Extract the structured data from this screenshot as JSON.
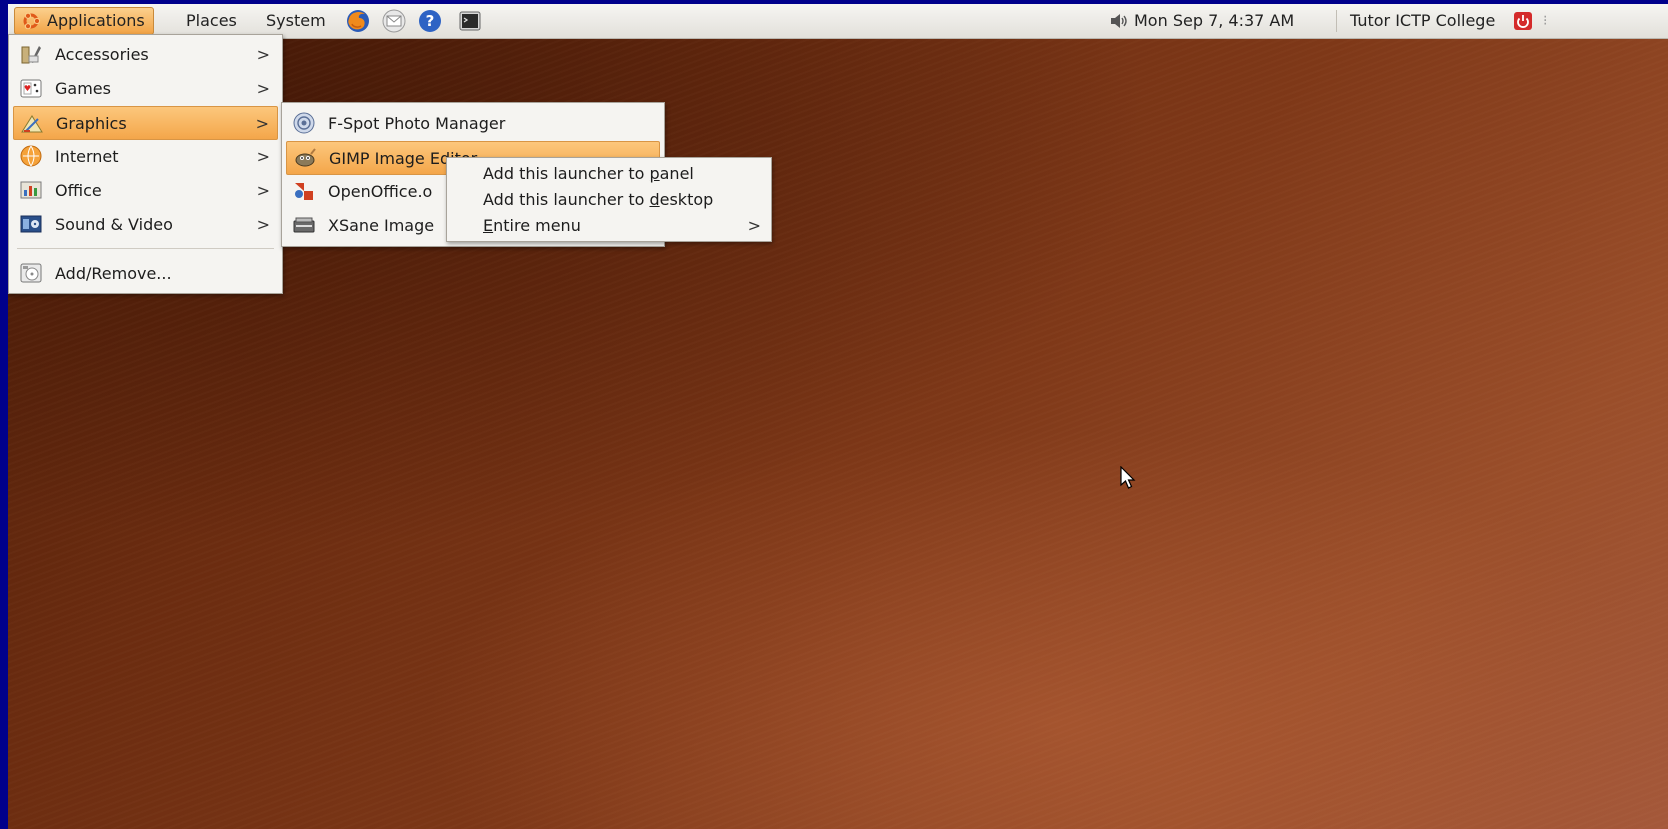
{
  "panel": {
    "applications_label": "Applications",
    "places_label": "Places",
    "system_label": "System",
    "clock": "Mon Sep  7,  4:37 AM",
    "user_name": "Tutor ICTP College"
  },
  "applications_menu": {
    "items": [
      {
        "label": "Accessories",
        "icon": "accessories-icon"
      },
      {
        "label": "Games",
        "icon": "games-icon"
      },
      {
        "label": "Graphics",
        "icon": "graphics-icon"
      },
      {
        "label": "Internet",
        "icon": "internet-icon"
      },
      {
        "label": "Office",
        "icon": "office-icon"
      },
      {
        "label": "Sound & Video",
        "icon": "sound-video-icon"
      }
    ],
    "add_remove_label": "Add/Remove..."
  },
  "graphics_submenu": {
    "items": [
      {
        "label": "F-Spot Photo Manager",
        "icon": "fspot-icon"
      },
      {
        "label": "GIMP Image Editor",
        "icon": "gimp-icon"
      },
      {
        "label": "OpenOffice.o",
        "icon": "openoffice-draw-icon"
      },
      {
        "label": "XSane Image",
        "icon": "xsane-icon"
      }
    ]
  },
  "context_menu": {
    "add_panel_prefix": "Add this launcher to ",
    "add_panel_key": "p",
    "add_panel_rest": "anel",
    "add_desktop_prefix": "Add this launcher to ",
    "add_desktop_key": "d",
    "add_desktop_rest": "esktop",
    "entire_menu_key": "E",
    "entire_menu_rest": "ntire menu"
  },
  "colors": {
    "highlight": "#f4a64a",
    "panel_bg": "#e9e7e2",
    "border_frame": "#00008b"
  }
}
